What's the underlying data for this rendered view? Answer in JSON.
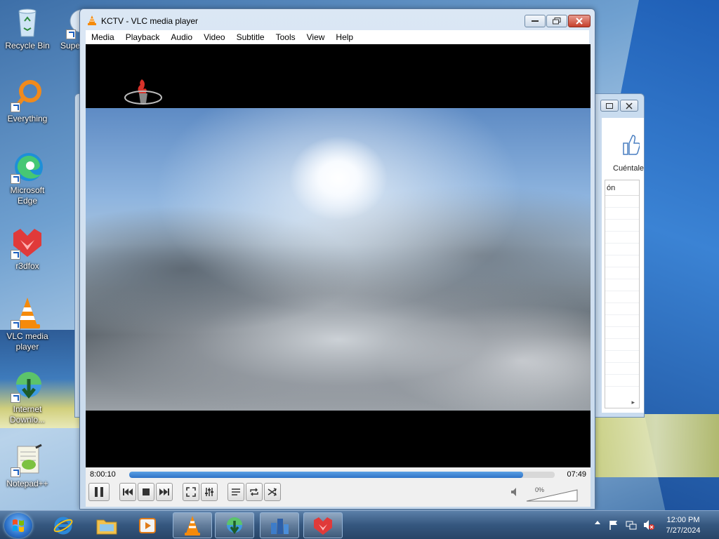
{
  "desktop": {
    "icons": [
      {
        "label": "Recycle Bin",
        "icon": "recycle-bin-icon"
      },
      {
        "label": "Supe",
        "icon": "app-icon"
      },
      {
        "label": "Everything",
        "icon": "everything-icon"
      },
      {
        "label": "Microsoft Edge",
        "icon": "edge-icon"
      },
      {
        "label": "r3dfox",
        "icon": "r3dfox-icon"
      },
      {
        "label": "VLC media player",
        "icon": "vlc-icon"
      },
      {
        "label": "Internet Downlo...",
        "icon": "idm-icon"
      },
      {
        "label": "Notepad++",
        "icon": "notepadpp-icon"
      }
    ]
  },
  "background_window": {
    "button_label": "Cuéntale",
    "column_header": "ón"
  },
  "vlc": {
    "title": "KCTV - VLC media player",
    "menu": [
      "Media",
      "Playback",
      "Audio",
      "Video",
      "Subtitle",
      "Tools",
      "View",
      "Help"
    ],
    "time_elapsed": "8:00:10",
    "time_remaining": "07:49",
    "seek_progress": 0.926,
    "volume_label": "0%",
    "volume_level": 0.0,
    "state": "playing",
    "accent_color": "#2f73c6"
  },
  "taskbar": {
    "items": [
      "start-button",
      "internet-explorer",
      "file-explorer",
      "media-player",
      "vlc",
      "internet-download-manager",
      "app-gallery",
      "r3dfox"
    ],
    "clock": {
      "time": "12:00 PM",
      "date": "7/27/2024"
    }
  }
}
